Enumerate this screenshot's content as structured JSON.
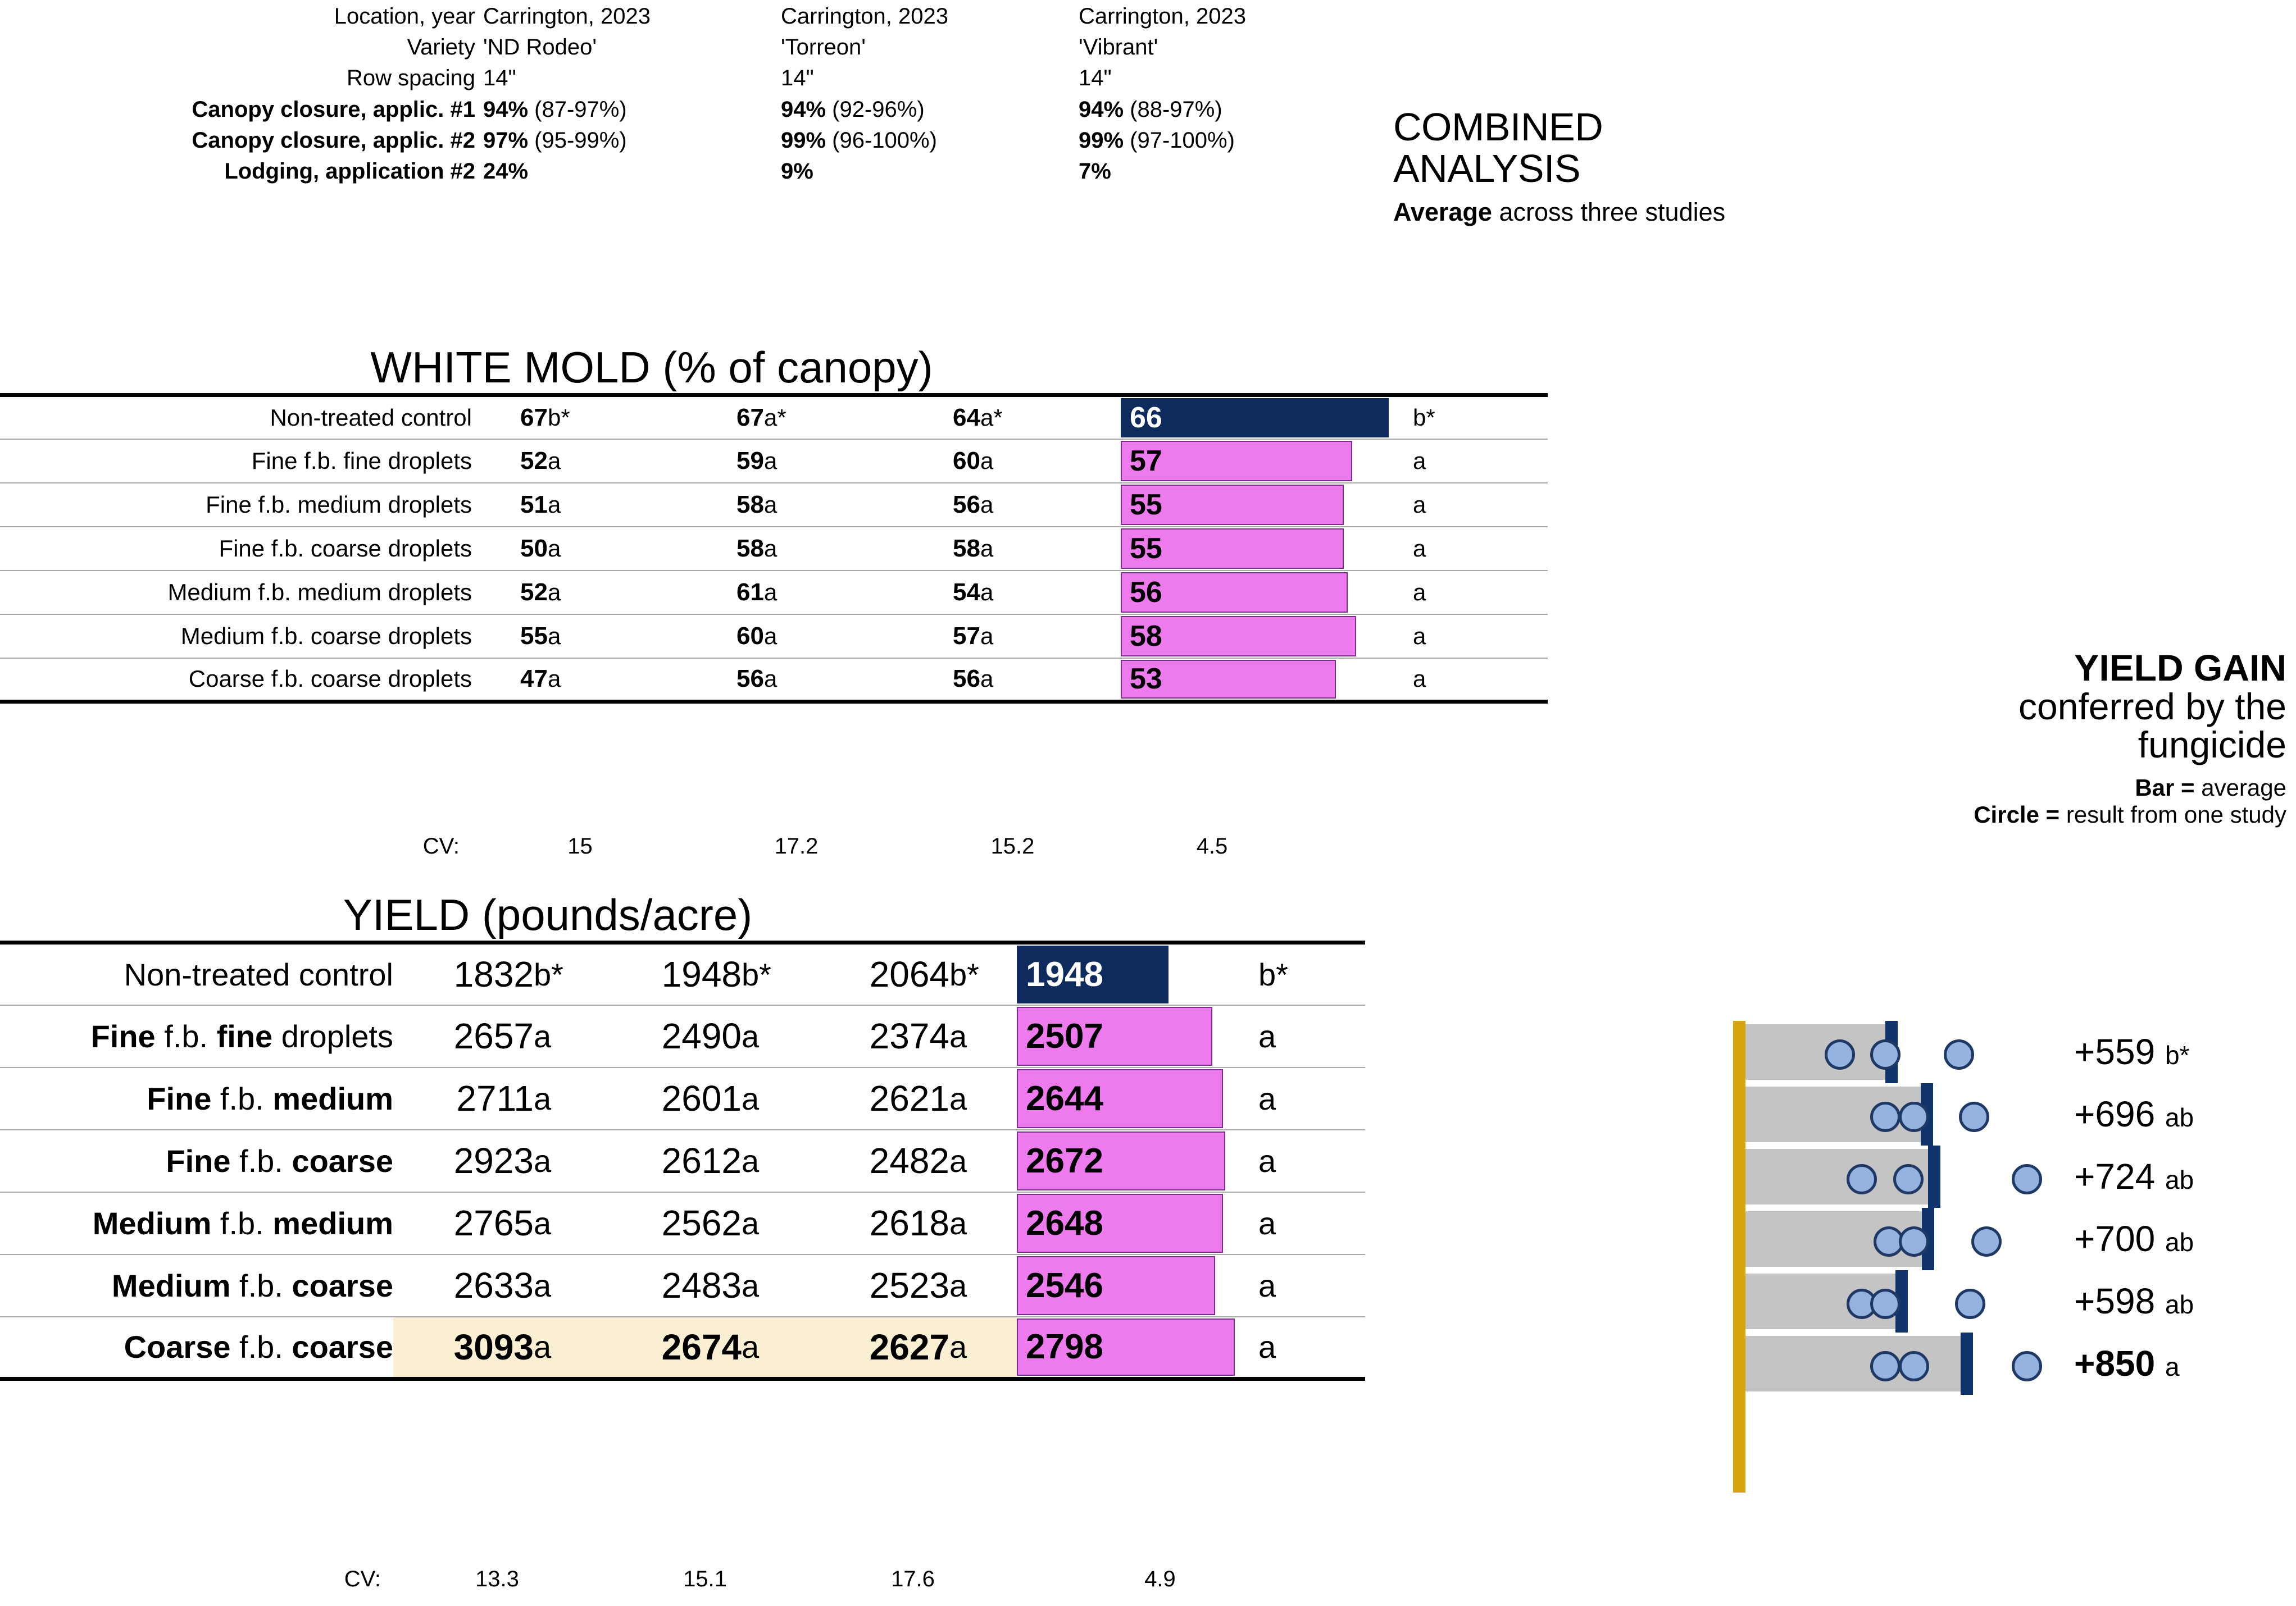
{
  "colors": {
    "navy": "#0D2B5C",
    "magenta": "#EE7BEE",
    "gold": "#D9A40C",
    "gray_bar": "#C4C4C4",
    "circle_fill": "#95B3E0",
    "circle_stroke": "#1F3864",
    "tick_navy": "#11336B",
    "highlight_row": "#FBEFD3"
  },
  "meta": {
    "rows": [
      {
        "label": "Location, year",
        "bold_label": false,
        "values": [
          {
            "bold": "",
            "rest": "Carrington, 2023"
          },
          {
            "bold": "",
            "rest": "Carrington, 2023"
          },
          {
            "bold": "",
            "rest": "Carrington, 2023"
          }
        ]
      },
      {
        "label": "Variety",
        "bold_label": false,
        "values": [
          {
            "bold": "",
            "rest": "'ND Rodeo'"
          },
          {
            "bold": "",
            "rest": "'Torreon'"
          },
          {
            "bold": "",
            "rest": "'Vibrant'"
          }
        ]
      },
      {
        "label": "Row spacing",
        "bold_label": false,
        "values": [
          {
            "bold": "",
            "rest": "14\""
          },
          {
            "bold": "",
            "rest": "14\""
          },
          {
            "bold": "",
            "rest": "14\""
          }
        ]
      },
      {
        "label": "Canopy closure, applic. #1",
        "bold_label": true,
        "values": [
          {
            "bold": "94%",
            "rest": " (87-97%)"
          },
          {
            "bold": "94%",
            "rest": " (92-96%)"
          },
          {
            "bold": "94%",
            "rest": " (88-97%)"
          }
        ]
      },
      {
        "label": "Canopy closure, applic. #2",
        "bold_label": true,
        "values": [
          {
            "bold": "97%",
            "rest": " (95-99%)"
          },
          {
            "bold": "99%",
            "rest": " (96-100%)"
          },
          {
            "bold": "99%",
            "rest": " (97-100%)"
          }
        ]
      },
      {
        "label": "Lodging, application #2",
        "bold_label": true,
        "values": [
          {
            "bold": "24%",
            "rest": ""
          },
          {
            "bold": "9%",
            "rest": ""
          },
          {
            "bold": "7%",
            "rest": ""
          }
        ]
      }
    ]
  },
  "combined": {
    "title_line1": "COMBINED",
    "title_line2": "ANALYSIS",
    "sub_bold": "Average",
    "sub_rest": " across three studies"
  },
  "yield_gain_caption": {
    "line1": "YIELD GAIN",
    "line2": "conferred by the",
    "line3": "fungicide",
    "legend_bar_bold": "Bar = ",
    "legend_bar_rest": "average",
    "legend_circle_bold": "Circle = ",
    "legend_circle_rest": "result from one study"
  },
  "white_mold": {
    "title": "WHITE MOLD (% of canopy)",
    "cv_label": "CV:",
    "cv_values": [
      "15",
      "17.2",
      "15.2",
      "4.5"
    ],
    "scale_max": 72,
    "rows": [
      {
        "label": "Non-treated control",
        "label_bold_parts": [],
        "c1": {
          "v": "67",
          "s": "b*"
        },
        "c2": {
          "v": "67",
          "s": "a*"
        },
        "c3": {
          "v": "64",
          "s": "a*"
        },
        "combined": {
          "v": 66,
          "vtext": "66",
          "s": "b*",
          "color": "navy",
          "text_color": "#ffffff"
        }
      },
      {
        "label": "Fine f.b. fine droplets",
        "label_bold_parts": [],
        "c1": {
          "v": "52",
          "s": "a"
        },
        "c2": {
          "v": "59",
          "s": "a"
        },
        "c3": {
          "v": "60",
          "s": "a"
        },
        "combined": {
          "v": 57,
          "vtext": "57",
          "s": "a",
          "color": "magenta",
          "text_color": "#000000"
        }
      },
      {
        "label": "Fine f.b. medium droplets",
        "label_bold_parts": [],
        "c1": {
          "v": "51",
          "s": "a"
        },
        "c2": {
          "v": "58",
          "s": "a"
        },
        "c3": {
          "v": "56",
          "s": "a"
        },
        "combined": {
          "v": 55,
          "vtext": "55",
          "s": "a",
          "color": "magenta",
          "text_color": "#000000"
        }
      },
      {
        "label": "Fine f.b. coarse droplets",
        "label_bold_parts": [],
        "c1": {
          "v": "50",
          "s": "a"
        },
        "c2": {
          "v": "58",
          "s": "a"
        },
        "c3": {
          "v": "58",
          "s": "a"
        },
        "combined": {
          "v": 55,
          "vtext": "55",
          "s": "a",
          "color": "magenta",
          "text_color": "#000000"
        }
      },
      {
        "label": "Medium f.b. medium droplets",
        "label_bold_parts": [],
        "c1": {
          "v": "52",
          "s": "a"
        },
        "c2": {
          "v": "61",
          "s": "a"
        },
        "c3": {
          "v": "54",
          "s": "a"
        },
        "combined": {
          "v": 56,
          "vtext": "56",
          "s": "a",
          "color": "magenta",
          "text_color": "#000000"
        }
      },
      {
        "label": "Medium f.b. coarse droplets",
        "label_bold_parts": [],
        "c1": {
          "v": "55",
          "s": "a"
        },
        "c2": {
          "v": "60",
          "s": "a"
        },
        "c3": {
          "v": "57",
          "s": "a"
        },
        "combined": {
          "v": 58,
          "vtext": "58",
          "s": "a",
          "color": "magenta",
          "text_color": "#000000"
        }
      },
      {
        "label": "Coarse f.b. coarse droplets",
        "label_bold_parts": [],
        "c1": {
          "v": "47",
          "s": "a"
        },
        "c2": {
          "v": "56",
          "s": "a"
        },
        "c3": {
          "v": "56",
          "s": "a"
        },
        "combined": {
          "v": 53,
          "vtext": "53",
          "s": "a",
          "color": "magenta",
          "text_color": "#000000"
        }
      }
    ]
  },
  "yield": {
    "title": "YIELD (pounds/acre)",
    "cv_label": "CV:",
    "cv_values": [
      "13.3",
      "15.1",
      "17.6",
      "4.9"
    ],
    "scale_max": 3100,
    "highlight_last_row": true,
    "rows": [
      {
        "label_html": "Non-treated control",
        "c1": {
          "v": "1832",
          "s": "b*"
        },
        "c2": {
          "v": "1948",
          "s": "b*"
        },
        "c3": {
          "v": "2064",
          "s": "b*"
        },
        "combined": {
          "v": 1948,
          "vtext": "1948",
          "s": "b*",
          "color": "navy",
          "text_color": "#ffffff"
        }
      },
      {
        "label_html": "<b>Fine</b> f.b. <b>fine</b> droplets",
        "c1": {
          "v": "2657",
          "s": "a"
        },
        "c2": {
          "v": "2490",
          "s": "a"
        },
        "c3": {
          "v": "2374",
          "s": "a"
        },
        "combined": {
          "v": 2507,
          "vtext": "2507",
          "s": "a",
          "color": "magenta",
          "text_color": "#000000"
        }
      },
      {
        "label_html": "<b>Fine</b> f.b. <b>medium</b>",
        "c1": {
          "v": "2711",
          "s": "a"
        },
        "c2": {
          "v": "2601",
          "s": "a"
        },
        "c3": {
          "v": "2621",
          "s": "a"
        },
        "combined": {
          "v": 2644,
          "vtext": "2644",
          "s": "a",
          "color": "magenta",
          "text_color": "#000000"
        }
      },
      {
        "label_html": "<b>Fine</b> f.b. <b>coarse</b>",
        "c1": {
          "v": "2923",
          "s": "a"
        },
        "c2": {
          "v": "2612",
          "s": "a"
        },
        "c3": {
          "v": "2482",
          "s": "a"
        },
        "combined": {
          "v": 2672,
          "vtext": "2672",
          "s": "a",
          "color": "magenta",
          "text_color": "#000000"
        }
      },
      {
        "label_html": "<b>Medium</b> f.b. <b>medium</b>",
        "c1": {
          "v": "2765",
          "s": "a"
        },
        "c2": {
          "v": "2562",
          "s": "a"
        },
        "c3": {
          "v": "2618",
          "s": "a"
        },
        "combined": {
          "v": 2648,
          "vtext": "2648",
          "s": "a",
          "color": "magenta",
          "text_color": "#000000"
        }
      },
      {
        "label_html": "<b>Medium</b> f.b. <b>coarse</b>",
        "c1": {
          "v": "2633",
          "s": "a"
        },
        "c2": {
          "v": "2483",
          "s": "a"
        },
        "c3": {
          "v": "2523",
          "s": "a"
        },
        "combined": {
          "v": 2546,
          "vtext": "2546",
          "s": "a",
          "color": "magenta",
          "text_color": "#000000"
        }
      },
      {
        "label_html": "<b>Coarse</b> f.b. <b>coarse</b>",
        "c1": {
          "v": "3093",
          "s": "a",
          "bold": true
        },
        "c2": {
          "v": "2674",
          "s": "a",
          "bold": true
        },
        "c3": {
          "v": "2627",
          "s": "a",
          "bold": true
        },
        "combined": {
          "v": 2798,
          "vtext": "2798",
          "s": "a",
          "color": "magenta",
          "text_color": "#000000",
          "bold": true
        }
      }
    ]
  },
  "chart_data": {
    "type": "bar",
    "title": "YIELD GAIN conferred by the fungicide",
    "xlabel": "",
    "ylabel": "",
    "note_bar": "Bar = average",
    "note_circle": "Circle = result from one study",
    "axis_zero_color": "#D9A40C",
    "xlim": [
      0,
      1000
    ],
    "categories": [
      "Fine f.b. fine droplets",
      "Fine f.b. medium",
      "Fine f.b. coarse",
      "Medium f.b. medium",
      "Medium f.b. coarse",
      "Coarse f.b. coarse"
    ],
    "series": [
      {
        "name": "Average yield gain (lb/acre)",
        "values": [
          559,
          696,
          724,
          700,
          598,
          850
        ]
      }
    ],
    "significance_letters": [
      "b*",
      "ab",
      "ab",
      "ab",
      "ab",
      "a"
    ],
    "labels": [
      "+559",
      "+696",
      "+724",
      "+700",
      "+598",
      "+850"
    ],
    "study_points": [
      {
        "category": "Fine f.b. fine droplets",
        "values": [
          366,
          542,
          825
        ]
      },
      {
        "category": "Fine f.b. medium",
        "values": [
          542,
          653,
          884
        ]
      },
      {
        "category": "Fine f.b. coarse",
        "values": [
          450,
          630,
          1090
        ]
      },
      {
        "category": "Medium f.b. medium",
        "values": [
          554,
          653,
          933
        ]
      },
      {
        "category": "Medium f.b. coarse",
        "values": [
          450,
          542,
          869
        ]
      },
      {
        "category": "Coarse f.b. coarse",
        "values": [
          542,
          653,
          1090
        ]
      }
    ]
  }
}
